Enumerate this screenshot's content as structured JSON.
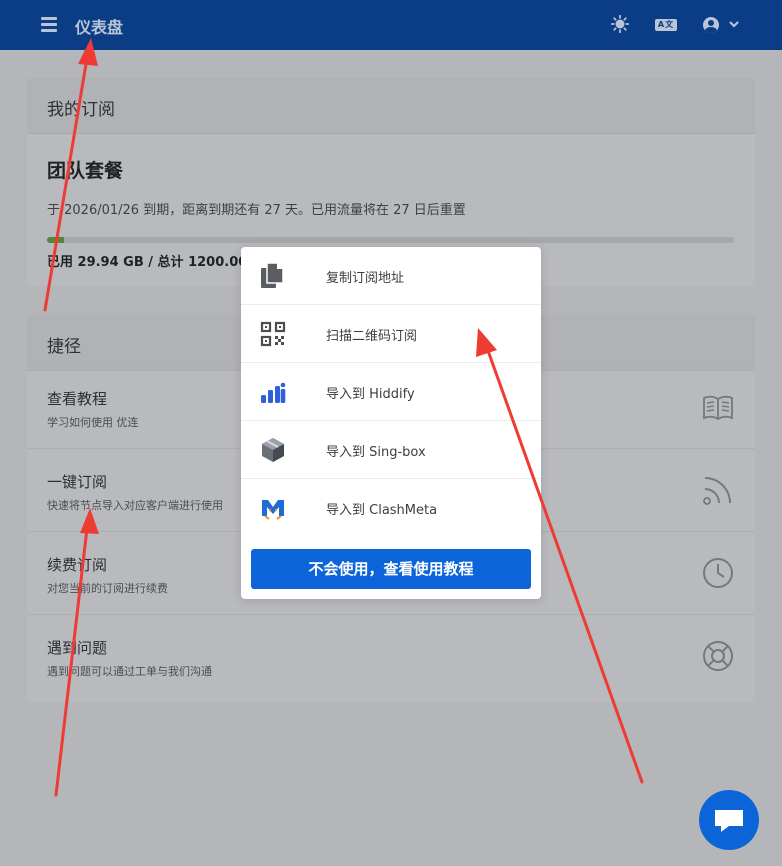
{
  "header": {
    "title": "仪表盘",
    "lang_icon_text": "A文",
    "bg_color": "#0a3d86"
  },
  "subscription": {
    "title": "我的订阅",
    "plan_name": "团队套餐",
    "description": "于 2026/01/26 到期，距离到期还有 27 天。已用流量将在 27 日后重置",
    "usage_text": "已用 29.94 GB / 总计 1200.00 GB",
    "usage_fraction": 0.025
  },
  "shortcuts": {
    "title": "捷径",
    "items": [
      {
        "title": "查看教程",
        "desc": "学习如何使用 优连",
        "icon": "book-icon"
      },
      {
        "title": "一键订阅",
        "desc": "快速将节点导入对应客户端进行使用",
        "icon": "rss-icon"
      },
      {
        "title": "续费订阅",
        "desc": "对您当前的订阅进行续费",
        "icon": "clock-icon"
      },
      {
        "title": "遇到问题",
        "desc": "遇到问题可以通过工单与我们沟通",
        "icon": "lifebuoy-icon"
      }
    ]
  },
  "dropdown": {
    "items": [
      {
        "label": "复制订阅地址",
        "icon": "copy-icon"
      },
      {
        "label": "扫描二维码订阅",
        "icon": "qrcode-icon"
      },
      {
        "label": "导入到 Hiddify",
        "icon": "hiddify-icon"
      },
      {
        "label": "导入到 Sing-box",
        "icon": "singbox-icon"
      },
      {
        "label": "导入到 ClashMeta",
        "icon": "clashmeta-icon"
      }
    ],
    "tutorial_button": "不会使用，查看使用教程",
    "accent_color": "#0b65d8"
  },
  "annotation_color": "#ee3b33"
}
